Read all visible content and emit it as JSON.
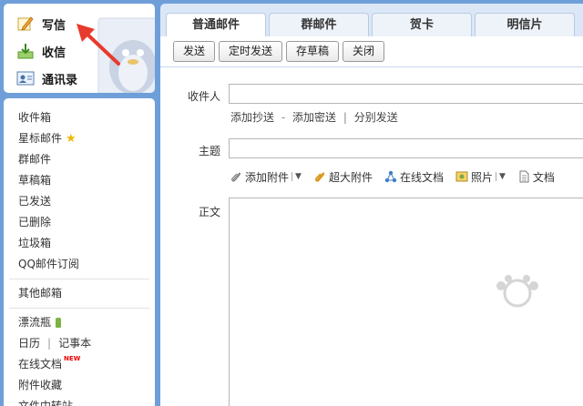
{
  "nav": {
    "write": "写信",
    "inbox": "收信",
    "contacts": "通讯录"
  },
  "folders": {
    "inbox": "收件箱",
    "starred": "星标邮件",
    "group": "群邮件",
    "drafts": "草稿箱",
    "sent": "已发送",
    "deleted": "已删除",
    "trash": "垃圾箱",
    "subscription": "QQ邮件订阅",
    "other": "其他邮箱",
    "bottle": "漂流瓶",
    "calendar": "日历",
    "separator": "|",
    "notes": "记事本",
    "online_docs": "在线文档",
    "new_badge": "NEW",
    "attachments": "附件收藏",
    "transfer": "文件中转站"
  },
  "tabs": [
    "普通邮件",
    "群邮件",
    "贺卡",
    "明信片"
  ],
  "toolbar": {
    "send": "发送",
    "scheduled": "定时发送",
    "save_draft": "存草稿",
    "close": "关闭"
  },
  "form": {
    "recipient_label": "收件人",
    "add_cc": "添加抄送",
    "dash": "-",
    "add_bcc": "添加密送",
    "pipe": "|",
    "separate_send": "分别发送",
    "subject_label": "主题",
    "body_label": "正文"
  },
  "attach": {
    "add_attachment": "添加附件",
    "large_attachment": "超大附件",
    "online_doc": "在线文档",
    "photo": "照片",
    "doc": "文档"
  },
  "colors": {
    "background": "#6f9fd8",
    "panel": "#dbe7f6",
    "arrow": "#e83a2d",
    "star": "#f2b800"
  }
}
